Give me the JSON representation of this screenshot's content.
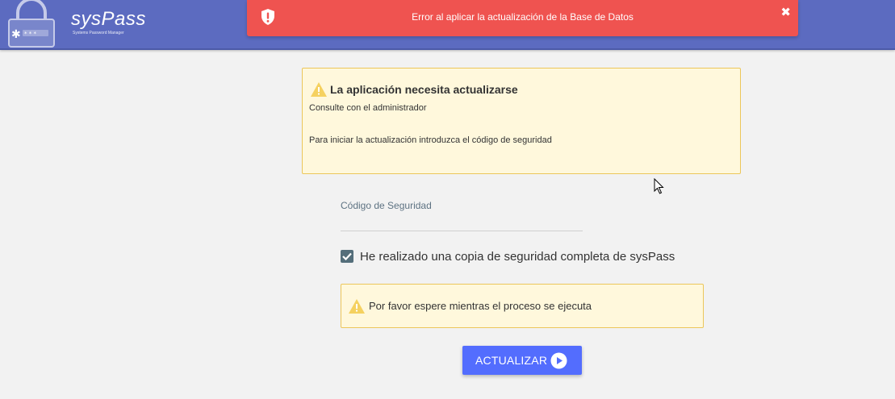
{
  "header": {
    "app_name": "sysPass",
    "app_subtitle": "Systems Password Manager",
    "color": "#5c6bc0"
  },
  "error_alert": {
    "message": "Error al aplicar la actualización de la Base de Datos",
    "icon": "shield-alert-icon",
    "close": "✖",
    "color": "#ef5350"
  },
  "update_notice": {
    "title": "La aplicación necesita actualizarse",
    "line1": "Consulte con el administrador",
    "line2": "Para iniciar la actualización introduzca el código de seguridad",
    "icon": "warning-icon"
  },
  "security_code": {
    "label": "Código de Seguridad",
    "value": "",
    "placeholder": ""
  },
  "backup_confirm": {
    "label": "He realizado una copia de seguridad completa de sysPass",
    "checked": true
  },
  "wait_notice": {
    "text": "Por favor espere mientras el proceso se ejecuta",
    "icon": "warning-icon"
  },
  "update_button": {
    "label": "ACTUALIZAR",
    "icon": "play-circle-icon",
    "color": "#536dfe"
  }
}
